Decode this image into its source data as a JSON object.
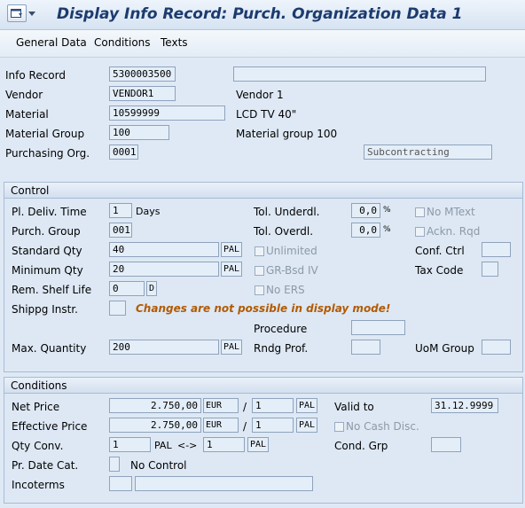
{
  "title": "Display Info Record: Purch. Organization Data 1",
  "toolbar": {
    "general_data": "General Data",
    "conditions": "Conditions",
    "texts": "Texts"
  },
  "header": {
    "info_record_label": "Info Record",
    "info_record_value": "5300003500",
    "info_record_desc": "",
    "vendor_label": "Vendor",
    "vendor_value": "VENDOR1",
    "vendor_desc": "Vendor 1",
    "material_label": "Material",
    "material_value": "10599999",
    "material_desc": "LCD TV 40\"",
    "material_group_label": "Material Group",
    "material_group_value": "100",
    "material_group_desc": "Material group 100",
    "purch_org_label": "Purchasing Org.",
    "purch_org_value": "0001",
    "subcontracting": "Subcontracting"
  },
  "control": {
    "title": "Control",
    "pl_deliv_time_label": "Pl. Deliv. Time",
    "pl_deliv_time_value": "1",
    "days": "Days",
    "purch_group_label": "Purch. Group",
    "purch_group_value": "001",
    "standard_qty_label": "Standard Qty",
    "standard_qty_value": "40",
    "standard_qty_unit": "PAL",
    "minimum_qty_label": "Minimum Qty",
    "minimum_qty_value": "20",
    "minimum_qty_unit": "PAL",
    "rem_shelf_life_label": "Rem. Shelf Life",
    "rem_shelf_life_value": "0",
    "rem_shelf_life_unit": "D",
    "shippg_instr_label": "Shippg Instr.",
    "message": "Changes are not possible in display mode!",
    "procedure_label": "Procedure",
    "max_quantity_label": "Max. Quantity",
    "max_quantity_value": "200",
    "max_quantity_unit": "PAL",
    "rndg_prof_label": "Rndg Prof.",
    "uom_group_label": "UoM Group",
    "tol_underdl_label": "Tol. Underdl.",
    "tol_underdl_value": "0,0",
    "tol_underdl_unit": "%",
    "tol_overdl_label": "Tol. Overdl.",
    "tol_overdl_value": "0,0",
    "tol_overdl_unit": "%",
    "unlimited_label": "Unlimited",
    "gr_bsd_iv_label": "GR-Bsd IV",
    "no_ers_label": "No ERS",
    "no_mtext_label": "No MText",
    "ackn_rqd_label": "Ackn. Rqd",
    "conf_ctrl_label": "Conf. Ctrl",
    "tax_code_label": "Tax Code"
  },
  "conditions": {
    "title": "Conditions",
    "net_price_label": "Net Price",
    "net_price_value": "2.750,00",
    "net_price_currency": "EUR",
    "net_price_per": "1",
    "net_price_unit": "PAL",
    "effective_price_label": "Effective Price",
    "effective_price_value": "2.750,00",
    "effective_price_currency": "EUR",
    "effective_price_per": "1",
    "effective_price_unit": "PAL",
    "slash": "/",
    "qty_conv_label": "Qty Conv.",
    "qty_conv_value1": "1",
    "qty_conv_unit1": "PAL",
    "qty_conv_arrow": "<->",
    "qty_conv_value2": "1",
    "qty_conv_unit2": "PAL",
    "pr_date_cat_label": "Pr. Date Cat.",
    "pr_date_cat_text": "No Control",
    "incoterms_label": "Incoterms",
    "valid_to_label": "Valid to",
    "valid_to_value": "31.12.9999",
    "no_cash_disc_label": "No Cash Disc.",
    "cond_grp_label": "Cond. Grp"
  },
  "icons": {
    "menu": "screen-menu-icon"
  },
  "colors": {
    "message": "#b35a00",
    "title": "#1c3b6e",
    "background": "#dfe9f5"
  }
}
